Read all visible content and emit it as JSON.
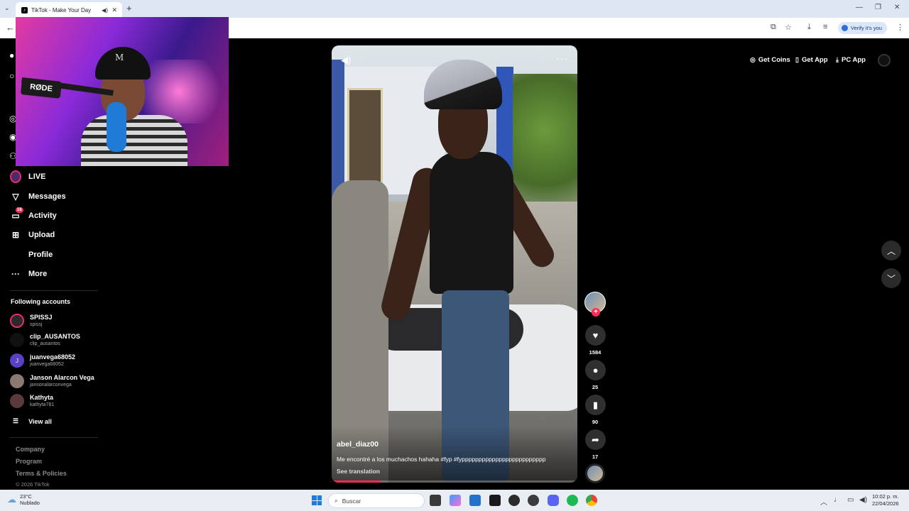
{
  "browser": {
    "tab_title": "TikTok - Make Your Day",
    "verify_label": "Verify it's you"
  },
  "sidebar": {
    "nav": [
      {
        "label": "LIVE",
        "icon": "live-icon"
      },
      {
        "label": "Messages",
        "icon": "paper-plane-icon"
      },
      {
        "label": "Activity",
        "icon": "inbox-icon",
        "badge": "16"
      },
      {
        "label": "Upload",
        "icon": "plus-square-icon"
      },
      {
        "label": "Profile",
        "icon": "profile-icon"
      },
      {
        "label": "More",
        "icon": "ellipsis-icon"
      }
    ],
    "following_title": "Following accounts",
    "following": [
      {
        "name": "SPISSJ",
        "handle": "spissj"
      },
      {
        "name": "clip_AUSANTOS",
        "handle": "clip_ausantos"
      },
      {
        "name": "juanvega68052",
        "handle": "juanvega68052",
        "initial": "J"
      },
      {
        "name": "Janson Alarcon Vega",
        "handle": "jansonalarconvega"
      },
      {
        "name": "Kathyta",
        "handle": "kathyta781"
      }
    ],
    "view_all": "View all",
    "footer": {
      "company": "Company",
      "program": "Program",
      "terms": "Terms & Policies",
      "copyright": "© 2026 TikTok"
    }
  },
  "header": {
    "get_coins": "Get Coins",
    "get_app": "Get App",
    "pc_app": "PC App"
  },
  "webcam": {
    "mic_brand": "RØDE"
  },
  "video": {
    "author": "abel_diaz00",
    "caption": "Me encontré a los muchachos hahaha #fyp #fyppppppppppppppppppppppppp",
    "see_translation": "See translation",
    "progress": 0.2
  },
  "actions": {
    "likes": "1584",
    "comments": "25",
    "saves": "90",
    "shares": "17"
  },
  "taskbar": {
    "temperature": "23°C",
    "weather": "Nublado",
    "search_placeholder": "Buscar",
    "time": "10:02 p. m.",
    "date": "22/04/2026"
  },
  "colors": {
    "accent": "#fe2c55",
    "background": "#000000",
    "taskbar": "#e9eef4"
  }
}
